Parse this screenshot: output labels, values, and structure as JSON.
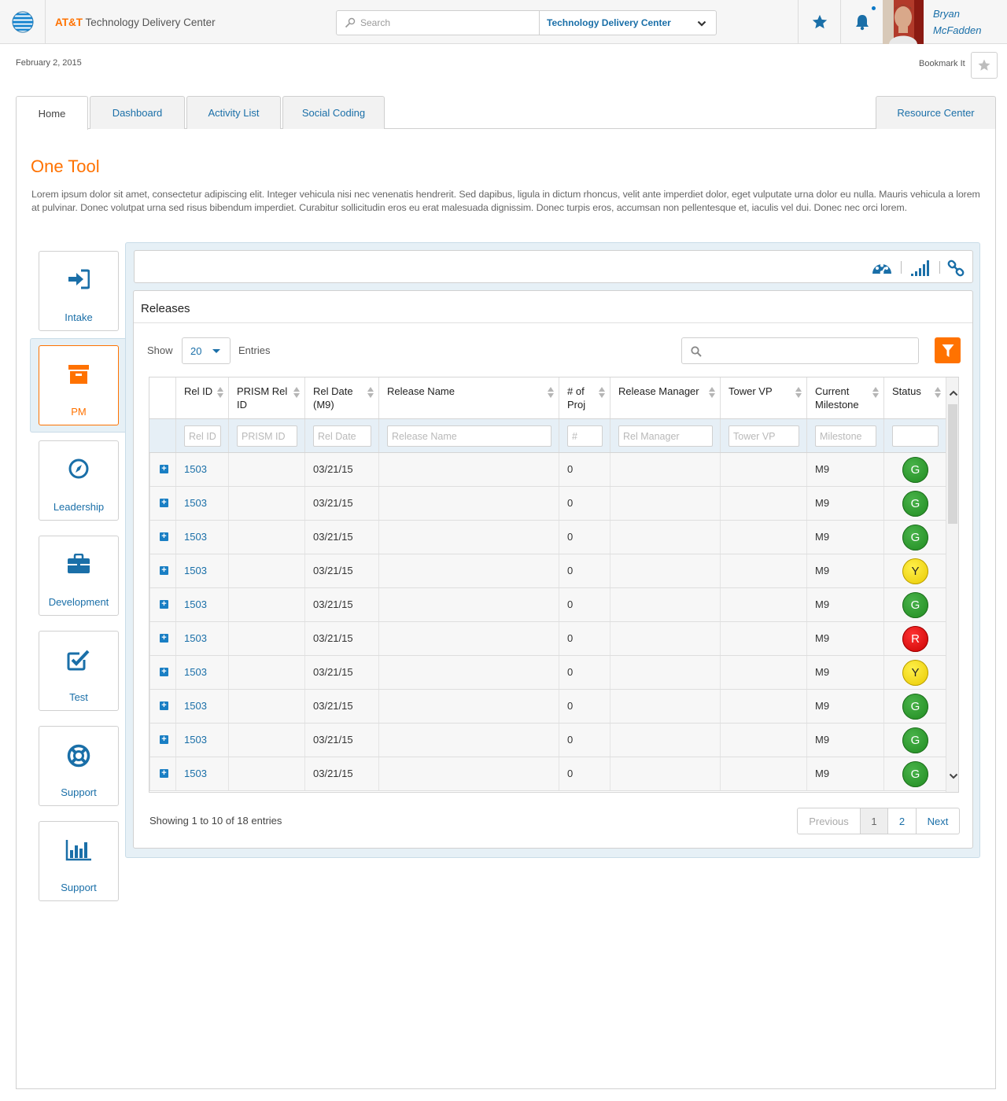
{
  "header": {
    "brand": "AT&T",
    "app_title": "Technology Delivery Center",
    "search_placeholder": "Search",
    "search_scope": "Technology Delivery Center",
    "user_first": "Bryan",
    "user_last": "McFadden"
  },
  "page": {
    "date": "February 2, 2015",
    "bookmark_label": "Bookmark It",
    "title": "One Tool",
    "intro": "Lorem ipsum dolor sit amet, consectetur adipiscing elit. Integer vehicula nisi nec venenatis hendrerit. Sed dapibus, ligula in dictum rhoncus, velit ante imperdiet dolor, eget vulputate urna dolor eu nulla. Mauris vehicula a lorem at pulvinar. Donec volutpat urna sed risus bibendum imperdiet. Curabitur sollicitudin eros eu erat malesuada dignissim. Donec turpis eros, accumsan non pellentesque et, iaculis vel dui. Donec nec orci lorem."
  },
  "tabs": [
    {
      "label": "Home",
      "active": true
    },
    {
      "label": "Dashboard"
    },
    {
      "label": "Activity List"
    },
    {
      "label": "Social Coding"
    },
    {
      "label": "Resource Center"
    }
  ],
  "nav": [
    {
      "label": "Intake",
      "icon": "sign-in-icon"
    },
    {
      "label": "PM",
      "icon": "archive-box-icon",
      "active": true
    },
    {
      "label": "Leadership",
      "icon": "compass-icon"
    },
    {
      "label": "Development",
      "icon": "briefcase-icon"
    },
    {
      "label": "Test",
      "icon": "checkbox-icon"
    },
    {
      "label": "Support",
      "icon": "lifebuoy-icon"
    },
    {
      "label": "Support",
      "icon": "bar-chart-icon"
    }
  ],
  "releases": {
    "title": "Releases",
    "show_label": "Show",
    "entries_value": "20",
    "entries_label": "Entries",
    "columns": [
      {
        "key": "expand",
        "label": ""
      },
      {
        "key": "rel_id",
        "label": "Rel ID",
        "filter": "Rel ID"
      },
      {
        "key": "prism_id",
        "label": "PRISM Rel ID",
        "filter": "PRISM ID"
      },
      {
        "key": "rel_date",
        "label": "Rel Date (M9)",
        "filter": "Rel Date"
      },
      {
        "key": "release_name",
        "label": "Release Name",
        "filter": "Release Name"
      },
      {
        "key": "num_proj",
        "label": "# of Proj",
        "filter": "#"
      },
      {
        "key": "rel_manager",
        "label": "Release Manager",
        "filter": "Rel Manager"
      },
      {
        "key": "tower_vp",
        "label": "Tower VP",
        "filter": "Tower VP"
      },
      {
        "key": "milestone",
        "label": "Current Milestone",
        "filter": "Milestone"
      },
      {
        "key": "status",
        "label": "Status",
        "filter": ""
      }
    ],
    "rows": [
      {
        "rel_id": "1503",
        "prism_id": "",
        "rel_date": "03/21/15",
        "release_name": "",
        "num_proj": "0",
        "rel_manager": "",
        "tower_vp": "",
        "milestone": "M9",
        "status": "G"
      },
      {
        "rel_id": "1503",
        "prism_id": "",
        "rel_date": "03/21/15",
        "release_name": "",
        "num_proj": "0",
        "rel_manager": "",
        "tower_vp": "",
        "milestone": "M9",
        "status": "G"
      },
      {
        "rel_id": "1503",
        "prism_id": "",
        "rel_date": "03/21/15",
        "release_name": "",
        "num_proj": "0",
        "rel_manager": "",
        "tower_vp": "",
        "milestone": "M9",
        "status": "G"
      },
      {
        "rel_id": "1503",
        "prism_id": "",
        "rel_date": "03/21/15",
        "release_name": "",
        "num_proj": "0",
        "rel_manager": "",
        "tower_vp": "",
        "milestone": "M9",
        "status": "Y"
      },
      {
        "rel_id": "1503",
        "prism_id": "",
        "rel_date": "03/21/15",
        "release_name": "",
        "num_proj": "0",
        "rel_manager": "",
        "tower_vp": "",
        "milestone": "M9",
        "status": "G"
      },
      {
        "rel_id": "1503",
        "prism_id": "",
        "rel_date": "03/21/15",
        "release_name": "",
        "num_proj": "0",
        "rel_manager": "",
        "tower_vp": "",
        "milestone": "M9",
        "status": "R"
      },
      {
        "rel_id": "1503",
        "prism_id": "",
        "rel_date": "03/21/15",
        "release_name": "",
        "num_proj": "0",
        "rel_manager": "",
        "tower_vp": "",
        "milestone": "M9",
        "status": "Y"
      },
      {
        "rel_id": "1503",
        "prism_id": "",
        "rel_date": "03/21/15",
        "release_name": "",
        "num_proj": "0",
        "rel_manager": "",
        "tower_vp": "",
        "milestone": "M9",
        "status": "G"
      },
      {
        "rel_id": "1503",
        "prism_id": "",
        "rel_date": "03/21/15",
        "release_name": "",
        "num_proj": "0",
        "rel_manager": "",
        "tower_vp": "",
        "milestone": "M9",
        "status": "G"
      },
      {
        "rel_id": "1503",
        "prism_id": "",
        "rel_date": "03/21/15",
        "release_name": "",
        "num_proj": "0",
        "rel_manager": "",
        "tower_vp": "",
        "milestone": "M9",
        "status": "G"
      }
    ],
    "showing": "Showing 1 to 10 of 18 entries",
    "pager": {
      "prev": "Previous",
      "pages": [
        "1",
        "2"
      ],
      "current": "1",
      "next": "Next"
    }
  },
  "colors": {
    "accent": "#ff7200",
    "link": "#1a6fa8",
    "status_green": "#2a9a2a",
    "status_yellow": "#f2d900",
    "status_red": "#e00000"
  }
}
